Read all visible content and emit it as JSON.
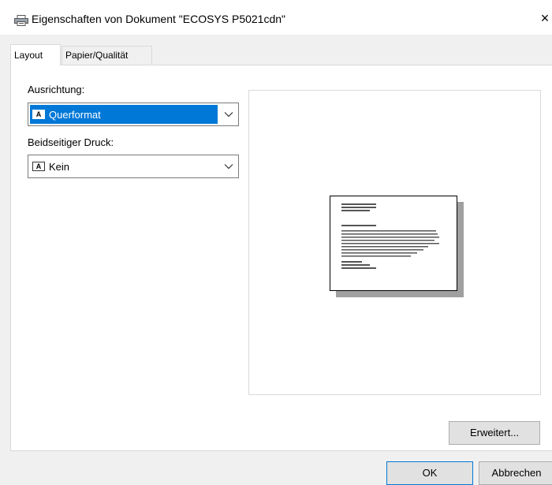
{
  "window": {
    "title": "Eigenschaften von Dokument \"ECOSYS P5021cdn\"",
    "close_glyph": "×",
    "icon": "printer-icon"
  },
  "tabs": [
    {
      "label": "Layout",
      "active": true
    },
    {
      "label": "Papier/Qualität",
      "active": false
    }
  ],
  "layout": {
    "orientation": {
      "label": "Ausrichtung:",
      "value": "Querformat",
      "icon_letter": "A",
      "icon": "landscape-orientation-icon"
    },
    "duplex": {
      "label": "Beidseitiger Druck:",
      "value": "Kein",
      "icon_letter": "A",
      "icon": "single-sided-icon"
    },
    "preview": {
      "icon": "page-preview-icon"
    },
    "advanced_button": "Erweitert..."
  },
  "footer": {
    "ok_label": "OK",
    "cancel_label": "Abbrechen"
  },
  "colors": {
    "accent": "#0078d7",
    "dialog_bg": "#f0f0f0",
    "panel_bg": "#ffffff",
    "button_bg": "#e1e1e1",
    "border": "#d9d9d9"
  }
}
